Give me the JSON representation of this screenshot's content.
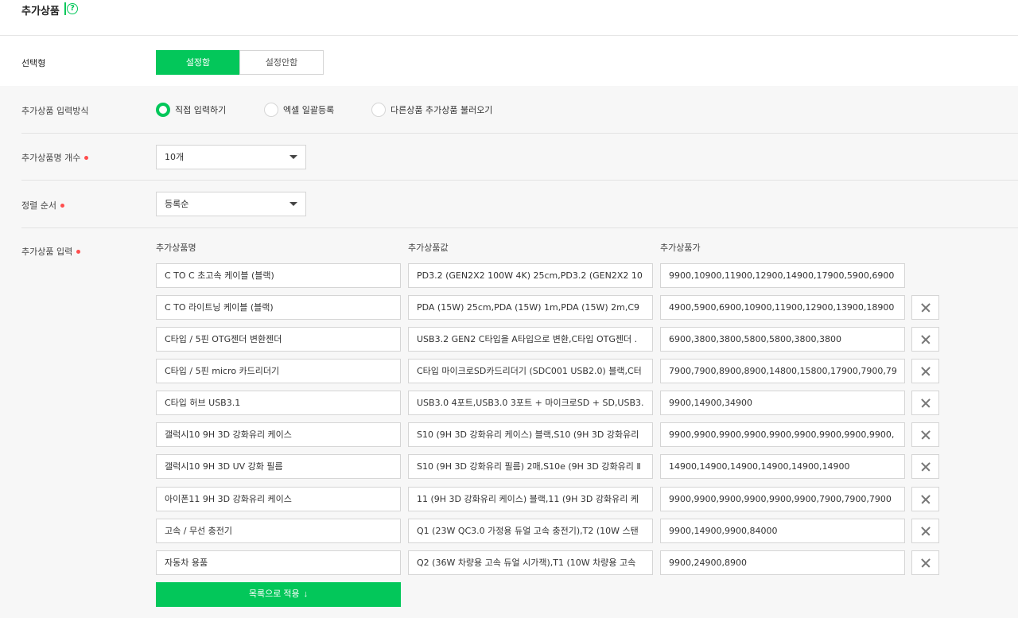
{
  "section": {
    "title": "추가상품",
    "help_icon": "question-circle-icon"
  },
  "selection_type": {
    "label": "선택형",
    "options": [
      "설정함",
      "설정안함"
    ],
    "selected": "설정함"
  },
  "input_method": {
    "label": "추가상품 입력방식",
    "options": [
      "직접 입력하기",
      "엑셀 일괄등록",
      "다른상품 추가상품 불러오기"
    ],
    "selected": "직접 입력하기"
  },
  "count": {
    "label": "추가상품명 개수",
    "value": "10개"
  },
  "sort": {
    "label": "정렬 순서",
    "value": "등록순"
  },
  "entries": {
    "label": "추가상품 입력",
    "headers": {
      "name": "추가상품명",
      "value": "추가상품값",
      "price": "추가상품가"
    },
    "rows": [
      {
        "name": "C TO C 초고속 케이블 (블랙)",
        "value": "PD3.2 (GEN2X2 100W 4K) 25cm,PD3.2 (GEN2X2 10",
        "price": "9900,10900,11900,12900,14900,17900,5900,6900"
      },
      {
        "name": "C TO 라이트닝 케이블 (블랙)",
        "value": "PDA (15W) 25cm,PDA (15W) 1m,PDA (15W) 2m,C9",
        "price": "4900,5900,6900,10900,11900,12900,13900,18900"
      },
      {
        "name": "C타입 / 5핀 OTG젠더 변환젠더",
        "value": "USB3.2 GEN2 C타입을 A타입으로 변환,C타입 OTG젠더 .",
        "price": "6900,3800,3800,5800,5800,3800,3800"
      },
      {
        "name": "C타입 / 5핀 micro 카드리더기",
        "value": "C타입 마이크로SD카드리더기 (SDC001 USB2.0) 블랙,C터",
        "price": "7900,7900,8900,8900,14800,15800,17900,7900,79"
      },
      {
        "name": "C타입 허브 USB3.1",
        "value": "USB3.0 4포트,USB3.0 3포트 + 마이크로SD + SD,USB3.",
        "price": "9900,14900,34900"
      },
      {
        "name": "갤럭시10 9H 3D 강화유리 케이스",
        "value": "S10 (9H 3D 강화유리 케이스) 블랙,S10 (9H 3D 강화유리",
        "price": "9900,9900,9900,9900,9900,9900,9900,9900,9900,"
      },
      {
        "name": "갤럭시10 9H 3D UV 강화 필름",
        "value": "S10 (9H 3D 강화유리 필름) 2매,S10e (9H 3D 강화유리 Ⅱ",
        "price": "14900,14900,14900,14900,14900,14900"
      },
      {
        "name": "아이폰11 9H 3D 강화유리 케이스",
        "value": "11 (9H 3D 강화유리 케이스) 블랙,11 (9H 3D 강화유리 케",
        "price": "9900,9900,9900,9900,9900,9900,7900,7900,7900"
      },
      {
        "name": "고속 / 무선 충전기",
        "value": "Q1 (23W QC3.0 가정용 듀얼 고속 충전기),T2 (10W 스탠",
        "price": "9900,14900,9900,84000"
      },
      {
        "name": "자동차 용품",
        "value": "Q2 (36W 차량용 고속 듀얼 시가잭),T1 (10W 차량용 고속",
        "price": "9900,24900,8900"
      }
    ],
    "delete_icon": "close-x-icon"
  },
  "apply_button": {
    "label": "목록으로 적용",
    "icon": "↓"
  },
  "colors": {
    "accent": "#03c75a",
    "required_dot": "#ff4d4d",
    "background_gray": "#f7f7f7"
  }
}
